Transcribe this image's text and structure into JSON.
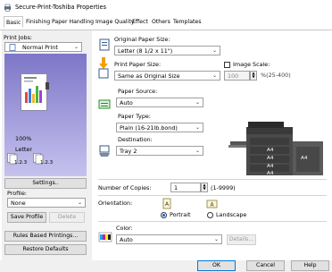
{
  "window": {
    "title": "Secure-Print-Toshiba Properties"
  },
  "tabs": [
    "Basic",
    "Finishing",
    "Paper Handling",
    "Image Quality",
    "Effect",
    "Others",
    "Templates"
  ],
  "left": {
    "print_jobs_label": "Print Jobs:",
    "print_job_value": "Normal Print",
    "preview_zoom": "100%",
    "preview_paper": "Letter",
    "preview_collate_a": "1.2.3",
    "preview_collate_b": "1.2.3",
    "settings_button": "Settings..",
    "profile_label": "Profile:",
    "profile_value": "None",
    "save_profile_button": "Save Profile",
    "delete_button": "Delete",
    "rules_button": "Rules Based Printings...",
    "restore_button": "Restore Defaults"
  },
  "paper": {
    "original_label": "Original Paper Size:",
    "original_value": "Letter (8 1/2 x 11\")",
    "print_label": "Print Paper Size:",
    "print_value": "Same as Original Size",
    "image_scale_label": "Image Scale:",
    "scale_value": "100",
    "scale_range": "%(25-400)",
    "source_label": "Paper Source:",
    "source_value": "Auto",
    "type_label": "Paper Type:",
    "type_value": "Plain (16-21lb.bond)",
    "destination_label": "Destination:",
    "destination_value": "Tray 2"
  },
  "copies": {
    "label": "Number of Copies:",
    "value": "1",
    "range": "(1-9999)"
  },
  "orientation": {
    "label": "Orientation:",
    "portrait": "Portrait",
    "landscape": "Landscape",
    "selected": "Portrait"
  },
  "color": {
    "label": "Color:",
    "value": "Auto",
    "details_button": "Details..."
  },
  "printer_tray_labels": [
    "A4",
    "A4",
    "A4",
    "A4",
    "A4"
  ],
  "footer": {
    "ok": "OK",
    "cancel": "Cancel",
    "help": "Help"
  }
}
